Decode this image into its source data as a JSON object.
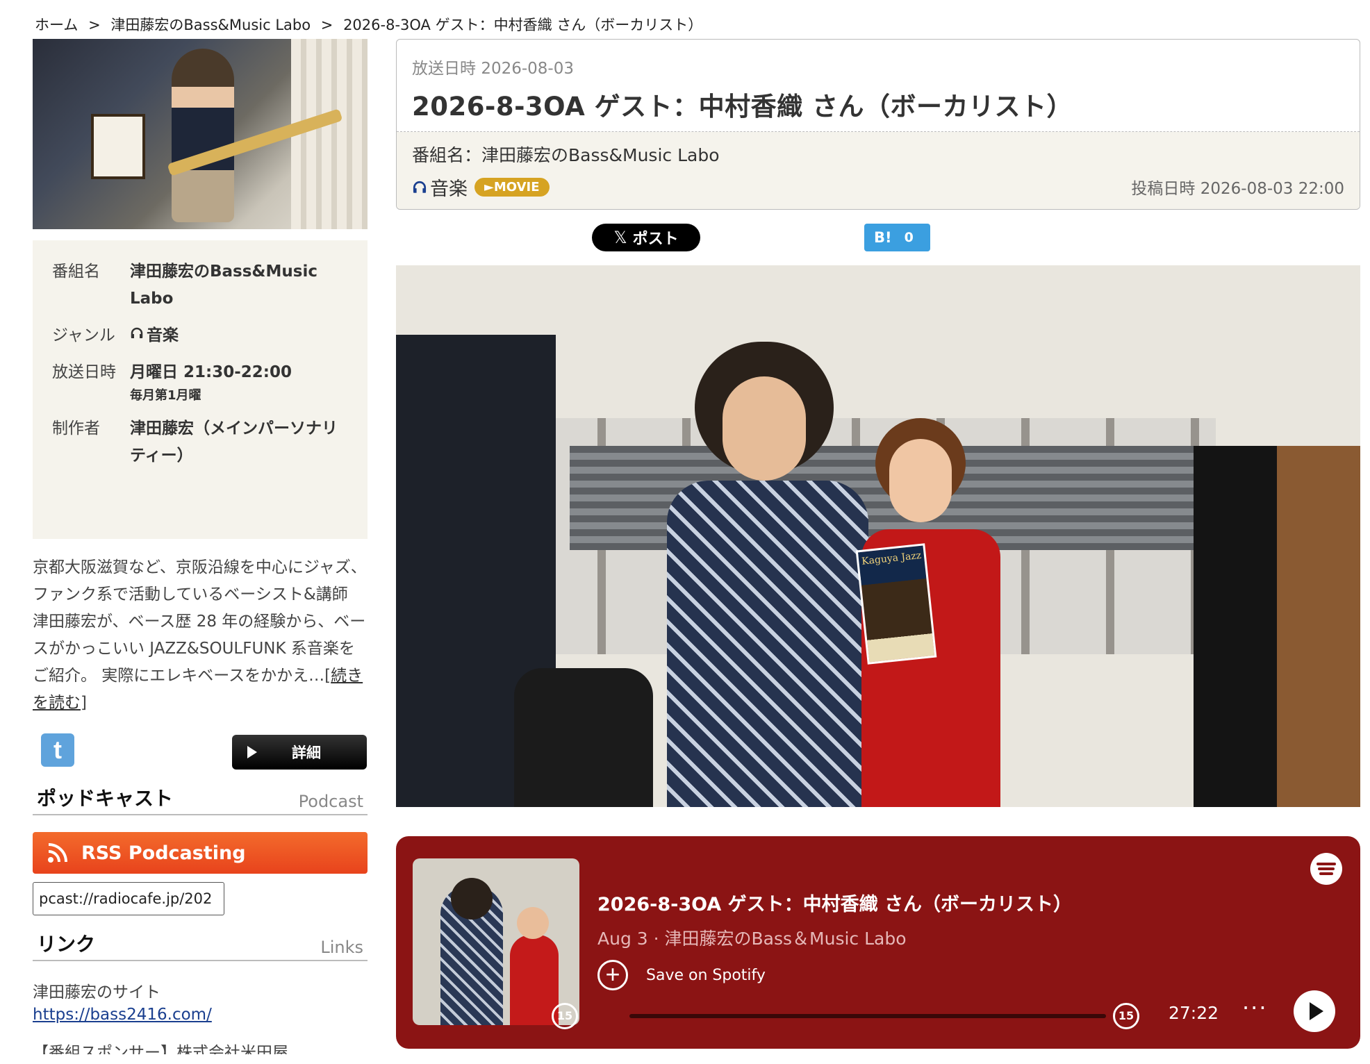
{
  "breadcrumb": {
    "home": "ホーム",
    "sep": ">",
    "program": "津田藤宏のBass&Music Labo",
    "current": "2026-8-3OA ゲスト：中村香織 さん（ボーカリスト）"
  },
  "program_info": {
    "rows": [
      {
        "key": "番組名",
        "value": "津田藤宏のBass&Music Labo",
        "sub": ""
      },
      {
        "key": "ジャンル",
        "value": "音楽",
        "sub": ""
      },
      {
        "key": "放送日時",
        "value": "月曜日 21:30-22:00",
        "sub": "毎月第1月曜"
      },
      {
        "key": "制作者",
        "value": "津田藤宏（メインパーソナリティー）",
        "sub": ""
      }
    ]
  },
  "description": {
    "text": "京都大阪滋賀など、京阪沿線を中心にジャズ、ファンク系で活動しているベーシスト&講師 津田藤宏が、ベース歴 28 年の経験から、ベースがかっこいい JAZZ&SOULFUNK 系音楽をご紹介。 実際にエレキベースをかかえ…",
    "read_more_open": "[",
    "read_more": "続きを読む",
    "read_more_close": "]"
  },
  "social": {
    "twitter_glyph": "t",
    "detail_label": "詳細"
  },
  "podcast": {
    "heading": "ポッドキャスト",
    "heading_en": "Podcast",
    "rss_label": "RSS Podcasting",
    "feed_value": "pcast://radiocafe.jp/202"
  },
  "links": {
    "heading": "リンク",
    "heading_en": "Links",
    "site_label": "津田藤宏のサイト",
    "site_url": "https://bass2416.com/",
    "sponsor": "【番組スポンサー】株式会社米田屋"
  },
  "episode": {
    "air_date_label": "放送日時",
    "air_date": "2026-08-03",
    "title": "2026-8-3OA ゲスト：中村香織 さん（ボーカリスト）",
    "program_label": "番組名：津田藤宏のBass&Music Labo",
    "genre": "音楽",
    "badge": "►MOVIE",
    "posted_label": "投稿日時",
    "posted": "2026-08-03 22:00"
  },
  "share": {
    "x_glyph": "𝕏",
    "x_label": "ポスト",
    "hatena_label": "B!",
    "hatena_count": "0"
  },
  "photo": {
    "flyer_text": "Kaguya Jazz"
  },
  "spotify": {
    "title": "2026-8-3OA ゲスト：中村香織 さん（ボーカリスト）",
    "subtitle": "Aug 3 · 津田藤宏のBass＆Music Labo",
    "save_label": "Save on Spotify",
    "rewind": "15",
    "forward": "15",
    "time": "27:22",
    "more": "···"
  },
  "colors": {
    "spotify_bg": "#8b1414",
    "rss": "#f05a24",
    "movie_badge": "#d6a322",
    "hatena": "#3b9fe0"
  }
}
